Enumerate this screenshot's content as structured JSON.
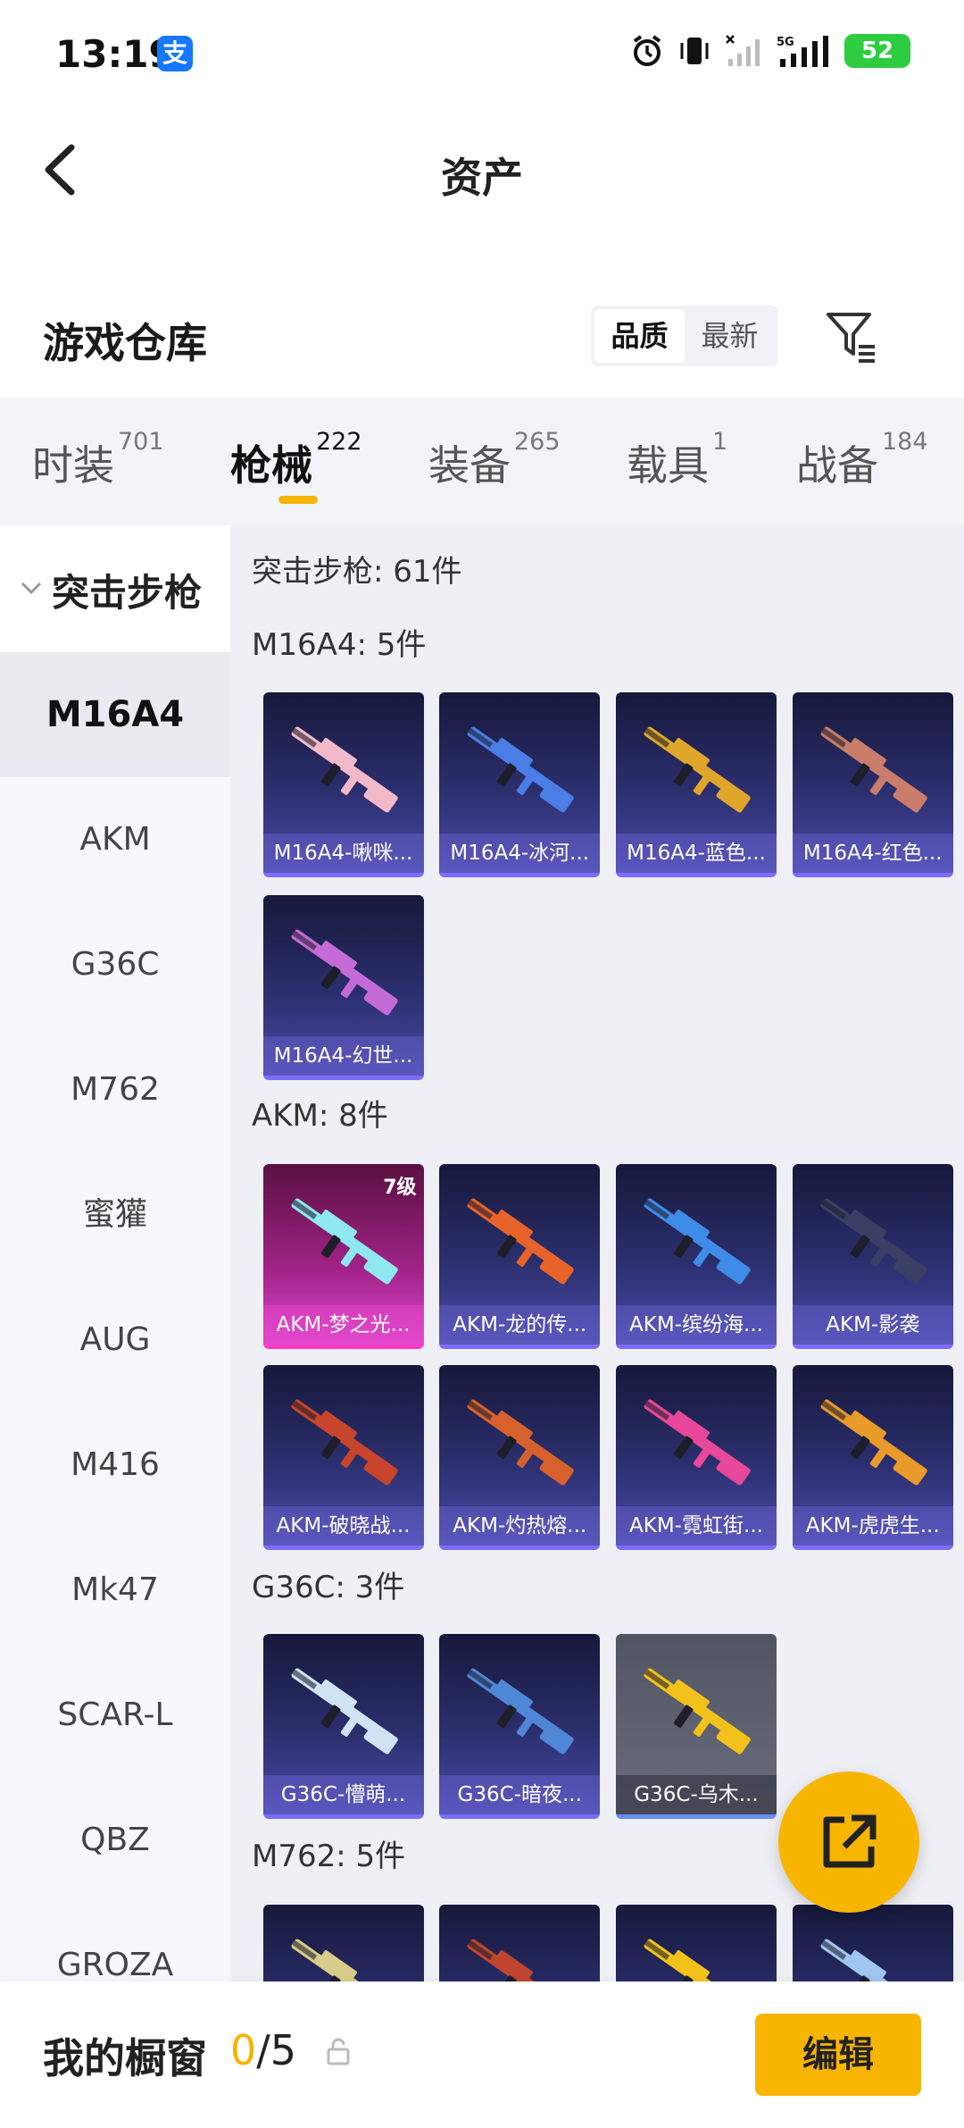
{
  "status_bar": {
    "time": "13:19",
    "alipay_glyph": "支",
    "network": "5G",
    "battery": "52"
  },
  "header": {
    "title": "资产"
  },
  "section": {
    "title": "游戏仓库",
    "sort_options": [
      "品质",
      "最新"
    ],
    "active_sort": "品质"
  },
  "category_tabs": [
    {
      "label": "时装",
      "count": "701"
    },
    {
      "label": "枪械",
      "count": "222"
    },
    {
      "label": "装备",
      "count": "265"
    },
    {
      "label": "载具",
      "count": "1"
    },
    {
      "label": "战备",
      "count": "184"
    }
  ],
  "sidebar": {
    "group": "突击步枪",
    "items": [
      "M16A4",
      "AKM",
      "G36C",
      "M762",
      "蜜獾",
      "AUG",
      "M416",
      "Mk47",
      "SCAR-L",
      "QBZ",
      "GROZA"
    ],
    "active": "M16A4"
  },
  "main": {
    "summary": "突击步枪: 61件",
    "groups": [
      {
        "label": "M16A4: 5件",
        "items": [
          {
            "name": "M16A4-啾咪...",
            "style": "purple",
            "gun_color": "#f2b9c9"
          },
          {
            "name": "M16A4-冰河...",
            "style": "purple",
            "gun_color": "#4a7ee6"
          },
          {
            "name": "M16A4-蓝色...",
            "style": "purple",
            "gun_color": "#e0a62a"
          },
          {
            "name": "M16A4-红色...",
            "style": "purple",
            "gun_color": "#c97d6a"
          },
          {
            "name": "M16A4-幻世...",
            "style": "purple",
            "gun_color": "#c56bd8"
          }
        ]
      },
      {
        "label": "AKM: 8件",
        "items": [
          {
            "name": "AKM-梦之光...",
            "style": "pink",
            "gun_color": "#8fe7f0",
            "level": "7级"
          },
          {
            "name": "AKM-龙的传...",
            "style": "purple",
            "gun_color": "#e8632a"
          },
          {
            "name": "AKM-缤纷海...",
            "style": "purple",
            "gun_color": "#3e8be8"
          },
          {
            "name": "AKM-影袭",
            "style": "purple",
            "gun_color": "#3b3f66"
          },
          {
            "name": "AKM-破晓战...",
            "style": "purple",
            "gun_color": "#c8442c"
          },
          {
            "name": "AKM-灼热熔...",
            "style": "purple",
            "gun_color": "#d7612d"
          },
          {
            "name": "AKM-霓虹街...",
            "style": "purple",
            "gun_color": "#e8489a"
          },
          {
            "name": "AKM-虎虎生...",
            "style": "purple",
            "gun_color": "#e89a2a"
          }
        ]
      },
      {
        "label": "G36C: 3件",
        "items": [
          {
            "name": "G36C-懵萌...",
            "style": "purple",
            "gun_color": "#cfe3f5"
          },
          {
            "name": "G36C-暗夜...",
            "style": "purple",
            "gun_color": "#4f86d6"
          },
          {
            "name": "G36C-乌木...",
            "style": "grey",
            "gun_color": "#f2c21b"
          }
        ]
      },
      {
        "label": "M762: 5件",
        "items": [
          {
            "name": "",
            "style": "purple",
            "gun_color": "#d8cc8a"
          },
          {
            "name": "",
            "style": "purple",
            "gun_color": "#c0452f"
          },
          {
            "name": "",
            "style": "purple",
            "gun_color": "#f2c21b"
          },
          {
            "name": "",
            "style": "purple",
            "gun_color": "#9fc6f0"
          }
        ]
      }
    ]
  },
  "bottom_bar": {
    "label": "我的橱窗",
    "current": "0",
    "total": "/5",
    "edit_label": "编辑"
  },
  "colors": {
    "accent": "#f7b500",
    "card_border": "#7b6dff"
  }
}
